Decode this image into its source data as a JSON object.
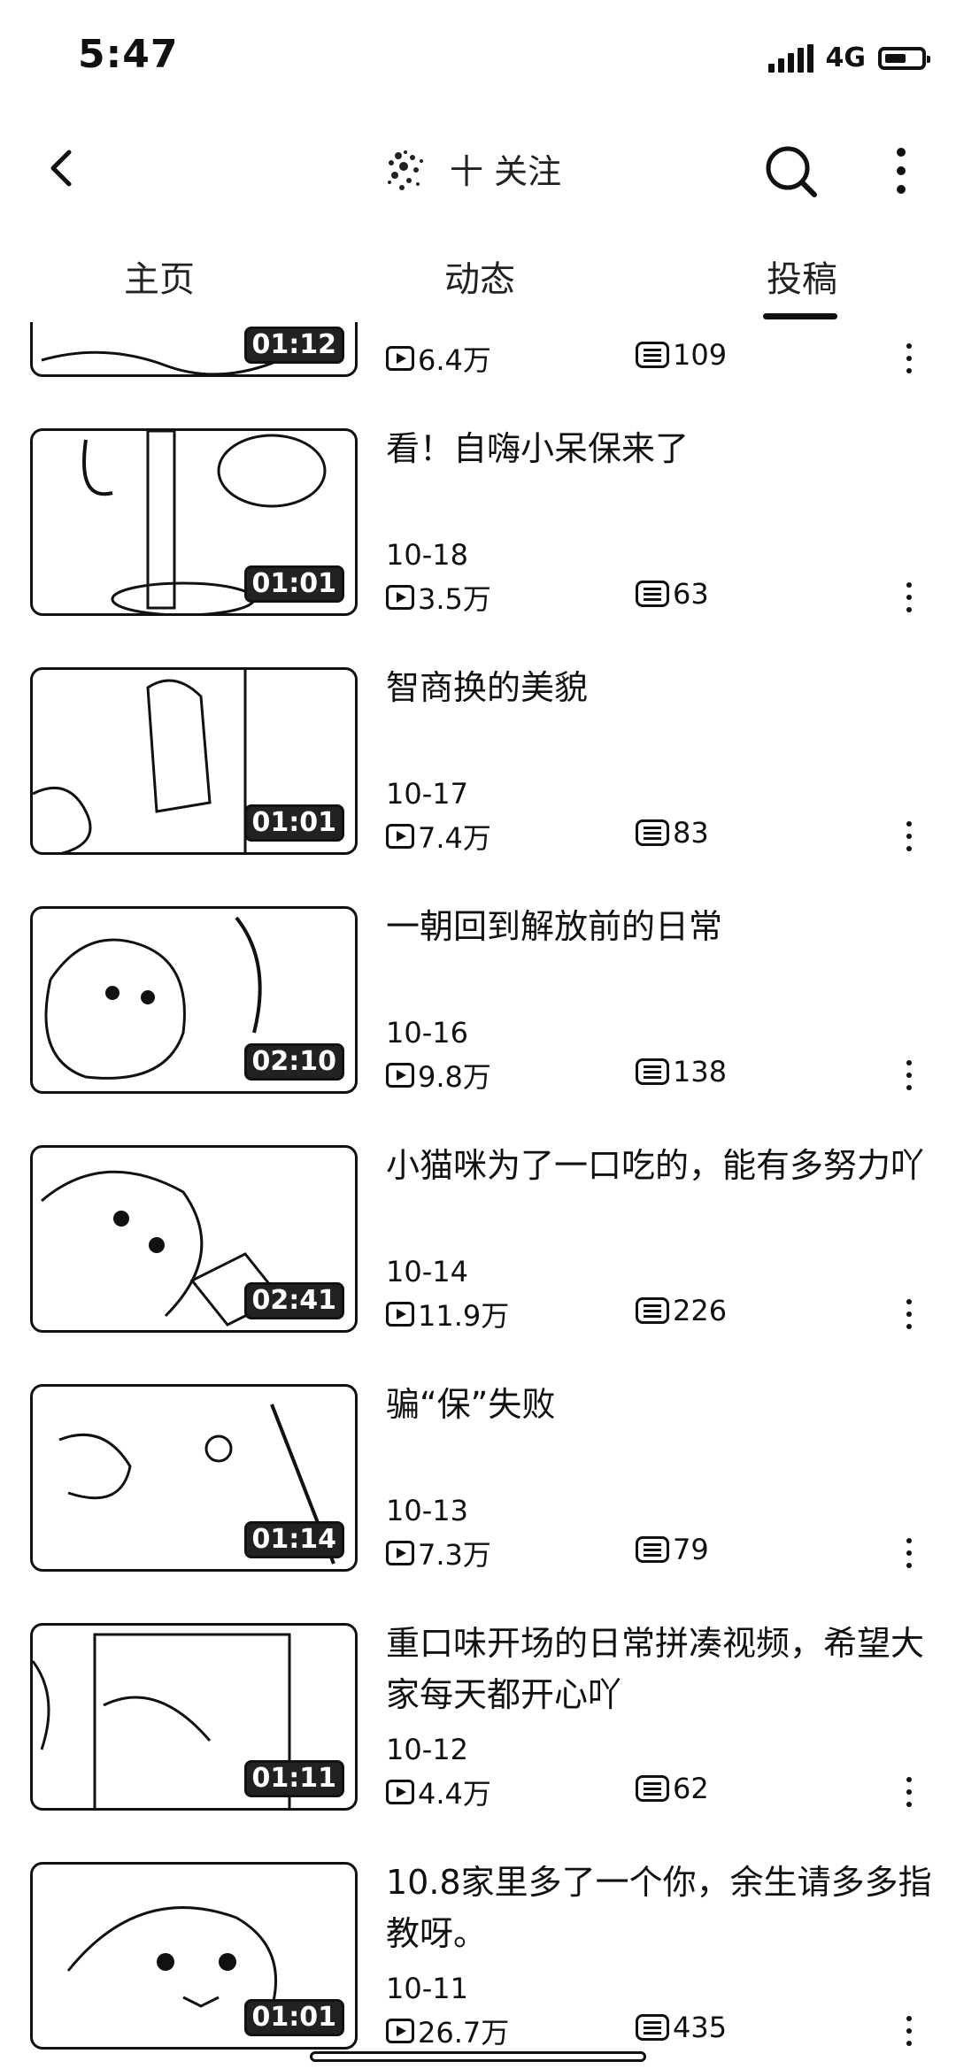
{
  "status_bar": {
    "time": "5:47",
    "network": "4G",
    "battery_percent": 60
  },
  "header": {
    "follow_label": "十 关注"
  },
  "tabs": {
    "home": "主页",
    "dynamic": "动态",
    "posts": "投稿",
    "active": "posts"
  },
  "videos": [
    {
      "title": "",
      "date": "",
      "duration": "01:12",
      "views": "6.4万",
      "comments": "109"
    },
    {
      "title": "看！自嗨小呆保来了",
      "date": "10-18",
      "duration": "01:01",
      "views": "3.5万",
      "comments": "63"
    },
    {
      "title": "智商换的美貌",
      "date": "10-17",
      "duration": "01:01",
      "views": "7.4万",
      "comments": "83"
    },
    {
      "title": "一朝回到解放前的日常",
      "date": "10-16",
      "duration": "02:10",
      "views": "9.8万",
      "comments": "138"
    },
    {
      "title": "小猫咪为了一口吃的，能有多努力吖",
      "date": "10-14",
      "duration": "02:41",
      "views": "11.9万",
      "comments": "226"
    },
    {
      "title": "骗“保”失败",
      "date": "10-13",
      "duration": "01:14",
      "views": "7.3万",
      "comments": "79"
    },
    {
      "title": "重口味开场的日常拼凑视频，希望大家每天都开心吖",
      "date": "10-12",
      "duration": "01:11",
      "views": "4.4万",
      "comments": "62"
    },
    {
      "title": "10.8家里多了一个你，余生请多多指教呀。",
      "date": "10-11",
      "duration": "01:01",
      "views": "26.7万",
      "comments": "435"
    }
  ],
  "icons": {
    "back": "chevron-left-icon",
    "search": "search-icon",
    "more": "more-vertical-icon",
    "views": "play-count-icon",
    "comments": "comment-icon"
  }
}
